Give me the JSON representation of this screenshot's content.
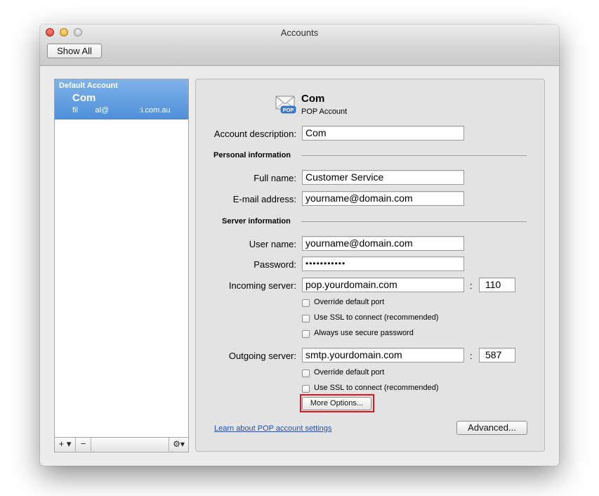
{
  "window": {
    "title": "Accounts"
  },
  "toolbar": {
    "show_all_label": "Show All"
  },
  "sidebar": {
    "section_header": "Default Account",
    "selected_account": {
      "name": "Com",
      "email_visible": "fil        al@              :i.com.au"
    },
    "bottom_bar": {
      "add_label": "+ ▾",
      "remove_label": "−",
      "gear_label": "⚙▾"
    }
  },
  "pane": {
    "account_name": "Com",
    "account_type": "POP Account",
    "account_description": {
      "label": "Account description:",
      "value": "Com"
    },
    "personal_information": {
      "heading": "Personal information",
      "full_name": {
        "label": "Full name:",
        "value": "Customer Service"
      },
      "email": {
        "label": "E-mail address:",
        "value": "yourname@domain.com"
      }
    },
    "server_information": {
      "heading": "Server information",
      "user_name": {
        "label": "User name:",
        "value": "yourname@domain.com"
      },
      "password": {
        "label": "Password:",
        "value": "•••••••••••"
      },
      "incoming": {
        "label": "Incoming server:",
        "value": "pop.yourdomain.com",
        "port": "110",
        "options": [
          {
            "label": "Override default port",
            "checked": false
          },
          {
            "label": "Use SSL to connect (recommended)",
            "checked": false
          },
          {
            "label": "Always use secure password",
            "checked": false
          }
        ]
      },
      "outgoing": {
        "label": "Outgoing server:",
        "value": "smtp.yourdomain.com",
        "port": "587",
        "options": [
          {
            "label": "Override default port",
            "checked": false
          },
          {
            "label": "Use SSL to connect (recommended)",
            "checked": false
          }
        ]
      },
      "port_separator": ":"
    },
    "more_options_label": "More Options...",
    "learn_link": "Learn about POP account settings",
    "advanced_label": "Advanced..."
  },
  "colors": {
    "selection": "#5a97de",
    "highlight_box": "#e0141a",
    "link": "#1f4fc7"
  },
  "icons": {
    "account_icon": "envelope-pop-icon",
    "gear": "gear-icon"
  }
}
